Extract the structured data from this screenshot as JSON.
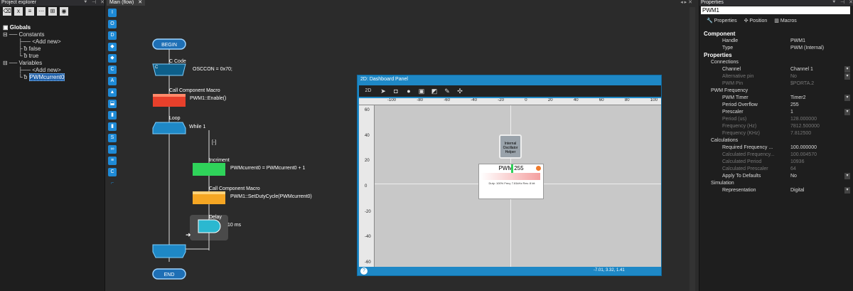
{
  "explorer": {
    "title": "Project explorer",
    "ctrl_pin": "⯆",
    "ctrl_dock": "⊣",
    "ctrl_close": "✕",
    "tree": {
      "globals": "Globals",
      "constants": "Constants",
      "add_new_1": "<Add new>",
      "false": "false",
      "true": "true",
      "variables": "Variables",
      "add_new_2": "<Add new>",
      "pwm_var": "PWMcurrent0"
    }
  },
  "main": {
    "tab": "Main (flow)",
    "tab_close": "✕",
    "ctrls": "◂ ▸ ✕",
    "flow": {
      "begin": "BEGIN",
      "c_code_label": "C Code",
      "c_code_text": "OSCCON = 0x70;",
      "macro1_label": "Call Component Macro",
      "macro1_text": "PWM1::Enable()",
      "loop_label": "Loop",
      "while_text": "While 1",
      "branch_mark": "[-]",
      "calc_label": "Incriment",
      "calc_text": "PWMcurrent0 = PWMcurrent0 + 1",
      "macro2_label": "Call Component Macro",
      "macro2_text": "PWM1::SetDutyCycle(PWMcurrent0)",
      "delay_label": "Delay",
      "delay_text": "10 ms",
      "end": "END"
    }
  },
  "dashboard": {
    "title": "2D: Dashboard Panel",
    "toolbar_label": "2D",
    "ruler_top": [
      "-100",
      "-80",
      "-60",
      "-40",
      "-20",
      "0",
      "20",
      "40",
      "60",
      "80",
      "100"
    ],
    "ruler_left": [
      "60",
      "40",
      "20",
      "0",
      "-20",
      "-40",
      "-60"
    ],
    "oscillator_label": "Internal Oscillator Helper",
    "pwm_label": "PWM 255",
    "pwm_info": "Duty: 100% Freq: 7.81kHz Res: 8 bit",
    "status_coords": "-7.01, 3.32, 1.41",
    "help": "?"
  },
  "properties": {
    "title": "Properties",
    "field_value": "PWM1",
    "tabs": [
      "Properties",
      "Position",
      "Macros"
    ],
    "rows": [
      {
        "kind": "cat",
        "k": "Component",
        "v": ""
      },
      {
        "kind": "row",
        "k": "Handle",
        "v": "PWM1"
      },
      {
        "kind": "row",
        "k": "Type",
        "v": "PWM (Internal)"
      },
      {
        "kind": "cat",
        "k": "Properties",
        "v": ""
      },
      {
        "kind": "sub",
        "k": "Connections",
        "v": ""
      },
      {
        "kind": "row",
        "k": "Channel",
        "v": "Channel 1",
        "dd": true
      },
      {
        "kind": "dis",
        "k": "Alternative pin",
        "v": "No",
        "dd": true
      },
      {
        "kind": "dis",
        "k": "PWM Pin",
        "v": "$PORTA.2"
      },
      {
        "kind": "sub",
        "k": "PWM Frequency",
        "v": ""
      },
      {
        "kind": "row",
        "k": "PWM Timer",
        "v": "Timer2",
        "dd": true
      },
      {
        "kind": "row",
        "k": "Period Overflow",
        "v": "255"
      },
      {
        "kind": "row",
        "k": "Prescaler",
        "v": "1",
        "dd": true
      },
      {
        "kind": "dis",
        "k": "Period (us)",
        "v": "128.000000"
      },
      {
        "kind": "dis",
        "k": "Frequency (Hz)",
        "v": "7812.500000"
      },
      {
        "kind": "dis",
        "k": "Frequency (KHz)",
        "v": "7.812500"
      },
      {
        "kind": "sub",
        "k": "Calculations",
        "v": ""
      },
      {
        "kind": "row",
        "k": "Required Frequency ...",
        "v": "100.000000"
      },
      {
        "kind": "dis",
        "k": "Calculated Frequency...",
        "v": "100.004570"
      },
      {
        "kind": "dis",
        "k": "Calculated Period",
        "v": "10936"
      },
      {
        "kind": "dis",
        "k": "Calculated Prescaler",
        "v": "64"
      },
      {
        "kind": "row",
        "k": "Apply To Defaults",
        "v": "No",
        "dd": true
      },
      {
        "kind": "sub",
        "k": "Simulation",
        "v": ""
      },
      {
        "kind": "row",
        "k": "Representation",
        "v": "Digital",
        "dd": true
      }
    ]
  }
}
